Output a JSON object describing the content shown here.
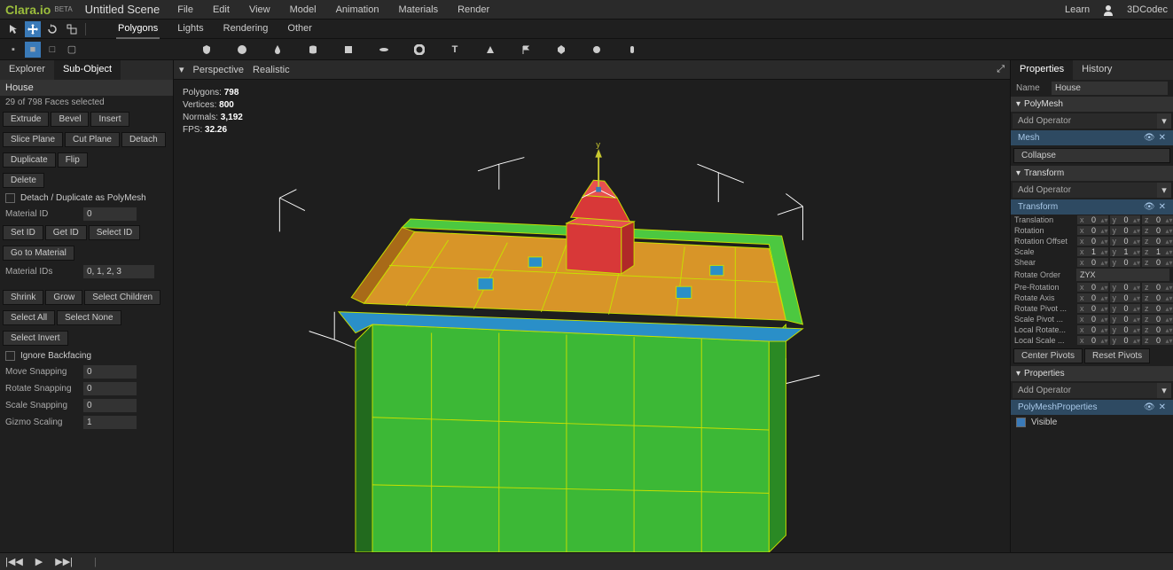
{
  "app": {
    "logo": "Clara.io",
    "beta": "BETA",
    "scene_title": "Untitled Scene"
  },
  "menu": [
    "File",
    "Edit",
    "View",
    "Model",
    "Animation",
    "Materials",
    "Render"
  ],
  "topright": {
    "learn": "Learn",
    "user": "3DCodec"
  },
  "tabs": [
    "Polygons",
    "Lights",
    "Rendering",
    "Other"
  ],
  "left": {
    "tabs": [
      "Explorer",
      "Sub-Object"
    ],
    "object": "House",
    "selection": "29 of 798 Faces selected",
    "edit_ops": [
      "Extrude",
      "Bevel",
      "Insert",
      "Slice Plane",
      "Cut Plane",
      "Detach",
      "Duplicate",
      "Flip"
    ],
    "delete": "Delete",
    "detach_chk": "Detach / Duplicate as PolyMesh",
    "material_id_lbl": "Material ID",
    "material_id": "0",
    "id_ops": [
      "Set ID",
      "Get ID",
      "Select ID"
    ],
    "goto_mat": "Go to Material",
    "mat_ids_lbl": "Material IDs",
    "mat_ids": "0, 1, 2, 3",
    "grow_ops": [
      "Shrink",
      "Grow",
      "Select Children"
    ],
    "sel_ops": [
      "Select All",
      "Select None"
    ],
    "sel_invert": "Select Invert",
    "ignore_bf": "Ignore Backfacing",
    "snap": [
      {
        "lbl": "Move Snapping",
        "val": "0"
      },
      {
        "lbl": "Rotate Snapping",
        "val": "0"
      },
      {
        "lbl": "Scale Snapping",
        "val": "0"
      },
      {
        "lbl": "Gizmo Scaling",
        "val": "1"
      }
    ]
  },
  "viewport": {
    "dropdown": "Perspective",
    "shading": "Realistic",
    "stats": {
      "poly_lbl": "Polygons:",
      "poly": "798",
      "vert_lbl": "Vertices:",
      "vert": "800",
      "norm_lbl": "Normals:",
      "norm": "3,192",
      "fps_lbl": "FPS:",
      "fps": "32.26"
    }
  },
  "right": {
    "tabs": [
      "Properties",
      "History"
    ],
    "name_lbl": "Name",
    "name": "House",
    "polymesh": "PolyMesh",
    "add_op": "Add Operator",
    "mesh": "Mesh",
    "collapse": "Collapse",
    "transform": "Transform",
    "transform_op": "Transform",
    "xyz": [
      {
        "lbl": "Translation",
        "x": "0",
        "y": "0",
        "z": "0"
      },
      {
        "lbl": "Rotation",
        "x": "0",
        "y": "0",
        "z": "0"
      },
      {
        "lbl": "Rotation Offset",
        "x": "0",
        "y": "0",
        "z": "0"
      },
      {
        "lbl": "Scale",
        "x": "1",
        "y": "1",
        "z": "1"
      },
      {
        "lbl": "Shear",
        "x": "0",
        "y": "0",
        "z": "0"
      }
    ],
    "rotate_order_lbl": "Rotate Order",
    "rotate_order": "ZYX",
    "xyz2": [
      {
        "lbl": "Pre-Rotation",
        "x": "0",
        "y": "0",
        "z": "0"
      },
      {
        "lbl": "Rotate Axis",
        "x": "0",
        "y": "0",
        "z": "0"
      },
      {
        "lbl": "Rotate Pivot ...",
        "x": "0",
        "y": "0",
        "z": "0"
      },
      {
        "lbl": "Scale Pivot ...",
        "x": "0",
        "y": "0",
        "z": "0"
      },
      {
        "lbl": "Local Rotate...",
        "x": "0",
        "y": "0",
        "z": "0"
      },
      {
        "lbl": "Local Scale ...",
        "x": "0",
        "y": "0",
        "z": "0"
      }
    ],
    "center_pivots": "Center Pivots",
    "reset_pivots": "Reset Pivots",
    "properties": "Properties",
    "polymesh_props": "PolyMeshProperties",
    "visible": "Visible"
  }
}
